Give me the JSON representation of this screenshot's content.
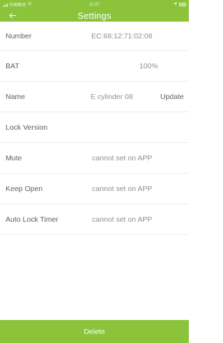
{
  "status_bar": {
    "carrier": "中国移动",
    "time": "11:07"
  },
  "navbar": {
    "title": "Settings",
    "back_icon": "arrow-left-icon"
  },
  "rows": [
    {
      "label": "Number",
      "value": "EC:68:12:71:02:08"
    },
    {
      "label": "BAT",
      "value": "100%"
    },
    {
      "label": "Name",
      "value": "E cylinder 08",
      "action": "Update"
    },
    {
      "label": "Lock Version",
      "value": ""
    },
    {
      "label": "Mute",
      "value": "cannot set on APP"
    },
    {
      "label": "Keep Open",
      "value": "cannot set on APP"
    },
    {
      "label": "Auto Lock Timer",
      "value": "cannot set on APP"
    }
  ],
  "footer": {
    "delete_label": "Delete"
  },
  "colors": {
    "accent": "#8bc33b",
    "divider": "#ececec"
  }
}
